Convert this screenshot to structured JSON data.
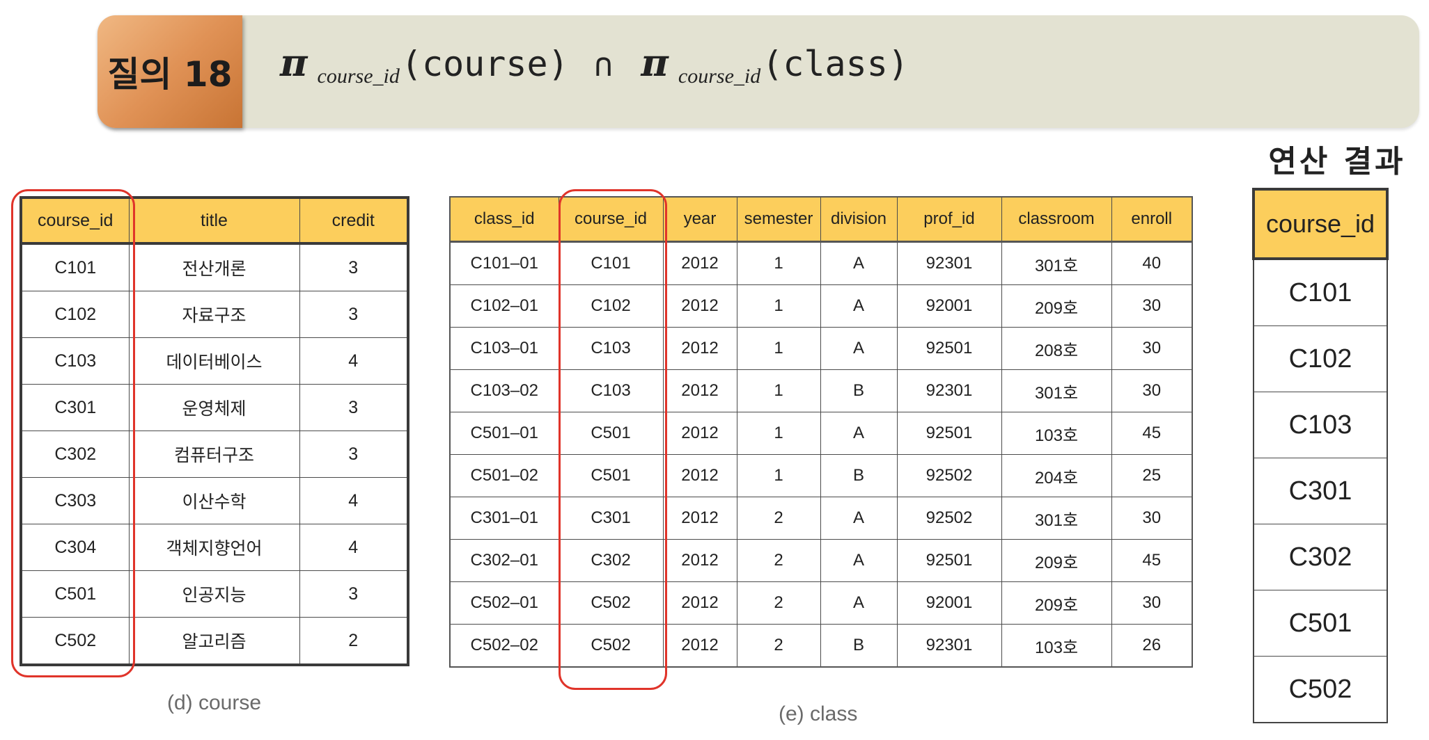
{
  "query": {
    "badge": "질의 18",
    "pi_symbol": "π",
    "left_subscript": "course_id",
    "left_relation": "(course)",
    "operator": "∩",
    "right_subscript": "course_id",
    "right_relation": "(class)"
  },
  "course_table": {
    "caption": "(d) course",
    "headers": [
      "course_id",
      "title",
      "credit"
    ],
    "rows": [
      [
        "C101",
        "전산개론",
        "3"
      ],
      [
        "C102",
        "자료구조",
        "3"
      ],
      [
        "C103",
        "데이터베이스",
        "4"
      ],
      [
        "C301",
        "운영체제",
        "3"
      ],
      [
        "C302",
        "컴퓨터구조",
        "3"
      ],
      [
        "C303",
        "이산수학",
        "4"
      ],
      [
        "C304",
        "객체지향언어",
        "4"
      ],
      [
        "C501",
        "인공지능",
        "3"
      ],
      [
        "C502",
        "알고리즘",
        "2"
      ]
    ]
  },
  "class_table": {
    "caption": "(e) class",
    "headers": [
      "class_id",
      "course_id",
      "year",
      "semester",
      "division",
      "prof_id",
      "classroom",
      "enroll"
    ],
    "rows": [
      [
        "C101–01",
        "C101",
        "2012",
        "1",
        "A",
        "92301",
        "301호",
        "40"
      ],
      [
        "C102–01",
        "C102",
        "2012",
        "1",
        "A",
        "92001",
        "209호",
        "30"
      ],
      [
        "C103–01",
        "C103",
        "2012",
        "1",
        "A",
        "92501",
        "208호",
        "30"
      ],
      [
        "C103–02",
        "C103",
        "2012",
        "1",
        "B",
        "92301",
        "301호",
        "30"
      ],
      [
        "C501–01",
        "C501",
        "2012",
        "1",
        "A",
        "92501",
        "103호",
        "45"
      ],
      [
        "C501–02",
        "C501",
        "2012",
        "1",
        "B",
        "92502",
        "204호",
        "25"
      ],
      [
        "C301–01",
        "C301",
        "2012",
        "2",
        "A",
        "92502",
        "301호",
        "30"
      ],
      [
        "C302–01",
        "C302",
        "2012",
        "2",
        "A",
        "92501",
        "209호",
        "45"
      ],
      [
        "C502–01",
        "C502",
        "2012",
        "2",
        "A",
        "92001",
        "209호",
        "30"
      ],
      [
        "C502–02",
        "C502",
        "2012",
        "2",
        "B",
        "92301",
        "103호",
        "26"
      ]
    ]
  },
  "result_table": {
    "title": "연산 결과",
    "header": "course_id",
    "rows": [
      "C101",
      "C102",
      "C103",
      "C301",
      "C302",
      "C501",
      "C502"
    ]
  },
  "colors": {
    "header_fill": "#fcce5c",
    "highlight": "#e0342a",
    "badge": "#e09256",
    "banner": "#e3e2d2"
  }
}
